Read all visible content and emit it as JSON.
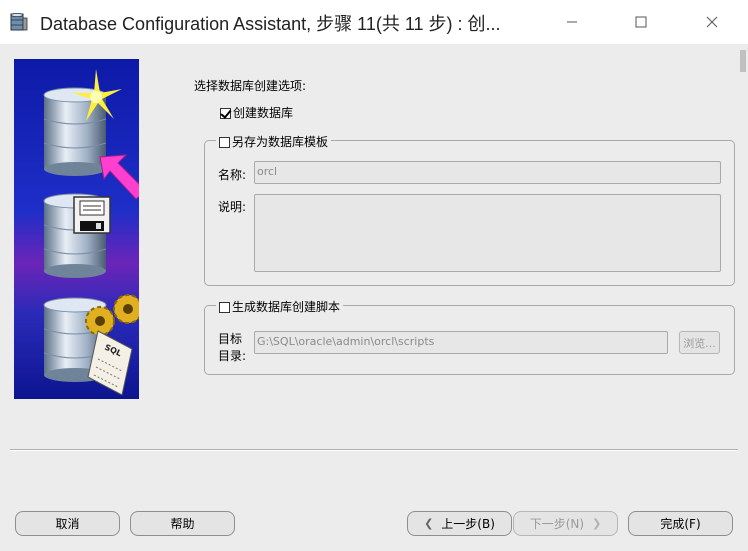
{
  "window": {
    "title": "Database Configuration Assistant, 步骤 11(共 11 步) : 创...",
    "icon": "database-app-icon",
    "controls": [
      "minimize",
      "maximize",
      "close"
    ]
  },
  "form": {
    "heading": "选择数据库创建选项:",
    "create_db": {
      "label": "创建数据库",
      "checked": true
    },
    "save_template": {
      "label": "另存为数据库模板",
      "checked": false,
      "name_label": "名称:",
      "name_value": "orcl",
      "desc_label": "说明:",
      "desc_value": ""
    },
    "gen_scripts": {
      "label": "生成数据库创建脚本",
      "checked": false,
      "dir_label_1": "目标",
      "dir_label_2": "目录:",
      "dir_value": "G:\\SQL\\oracle\\admin\\orcl\\scripts",
      "browse_label": "浏览..."
    }
  },
  "footer": {
    "cancel": "取消",
    "help": "帮助",
    "back": "上一步(B)",
    "next": "下一步(N)",
    "finish": "完成(F)"
  },
  "graphic": {
    "sql_label": "SQL"
  }
}
